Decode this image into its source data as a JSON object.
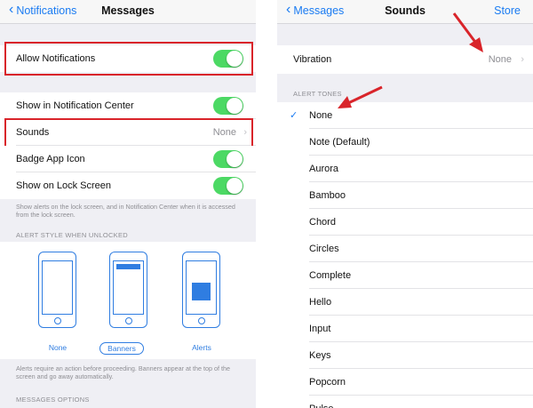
{
  "left": {
    "nav": {
      "back_label": "Notifications",
      "title": "Messages"
    },
    "rows": {
      "allow_notifications": "Allow Notifications",
      "show_in_center": "Show in Notification Center",
      "sounds": "Sounds",
      "sounds_value": "None",
      "badge": "Badge App Icon",
      "lock_screen": "Show on Lock Screen"
    },
    "lock_footer": "Show alerts on the lock screen, and in Notification Center when it is accessed from the lock screen.",
    "alert_style_header": "ALERT STYLE WHEN UNLOCKED",
    "alert_styles": [
      "None",
      "Banners",
      "Alerts"
    ],
    "alert_style_selected": "Banners",
    "style_footer": "Alerts require an action before proceeding. Banners appear at the top of the screen and go away automatically.",
    "messages_options_header": "MESSAGES OPTIONS"
  },
  "right": {
    "nav": {
      "back_label": "Messages",
      "title": "Sounds",
      "right_label": "Store"
    },
    "vibration_label": "Vibration",
    "vibration_value": "None",
    "alert_tones_header": "ALERT TONES",
    "tones": [
      "None",
      "Note (Default)",
      "Aurora",
      "Bamboo",
      "Chord",
      "Circles",
      "Complete",
      "Hello",
      "Input",
      "Keys",
      "Popcorn",
      "Pulse"
    ],
    "selected_tone": "None"
  },
  "colors": {
    "accent": "#1a7bf2",
    "toggle_on": "#4cd964",
    "highlight": "#d9242a"
  }
}
